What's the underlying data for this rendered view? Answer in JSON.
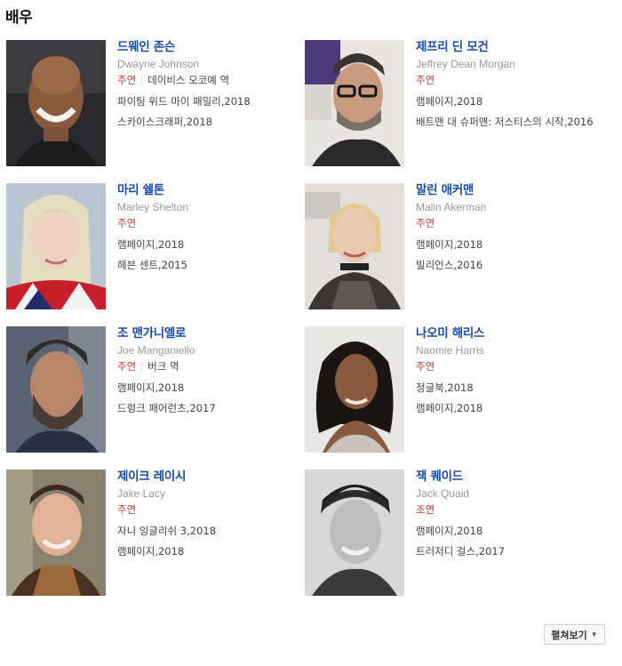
{
  "section_title": "배우",
  "more_label": "펼쳐보기",
  "actors": [
    {
      "name": "드웨인 존슨",
      "ename": "Dwayne Johnson",
      "role": "주연",
      "char": "데이비스 오코예 역",
      "works": [
        "파이팅 위드 마이 패밀리,2018",
        "스카이스크래퍼,2018"
      ]
    },
    {
      "name": "제프리 딘 모건",
      "ename": "Jeffrey Dean Morgan",
      "role": "주연",
      "char": "",
      "works": [
        "램페이지,2018",
        "배트맨 대 슈퍼맨: 저스티스의 시작,2016"
      ]
    },
    {
      "name": "마리 쉘톤",
      "ename": "Marley Shelton",
      "role": "주연",
      "char": "",
      "works": [
        "램페이지,2018",
        "헤븐 센트,2015"
      ]
    },
    {
      "name": "말린 애커맨",
      "ename": "Malin Akerman",
      "role": "주연",
      "char": "",
      "works": [
        "램페이지,2018",
        "빌리언스,2016"
      ]
    },
    {
      "name": "조 맨가니엘로",
      "ename": "Joe Manganiello",
      "role": "주연",
      "char": "버크 역",
      "works": [
        "램페이지,2018",
        "드렁크 패어런츠,2017"
      ]
    },
    {
      "name": "나오미 해리스",
      "ename": "Naomie Harris",
      "role": "주연",
      "char": "",
      "works": [
        "정글북,2018",
        "램페이지,2018"
      ]
    },
    {
      "name": "제이크 레이시",
      "ename": "Jake Lacy",
      "role": "주연",
      "char": "",
      "works": [
        "자니 잉글리쉬 3,2018",
        "램페이지,2018"
      ]
    },
    {
      "name": "잭 퀘이드",
      "ename": "Jack Quaid",
      "role": "조연",
      "char": "",
      "works": [
        "램페이지,2018",
        "트러저디 걸스,2017"
      ]
    }
  ],
  "colors": {
    "name_link": "#1a4ab0",
    "role": "#d2362f",
    "english_name": "#999999"
  }
}
